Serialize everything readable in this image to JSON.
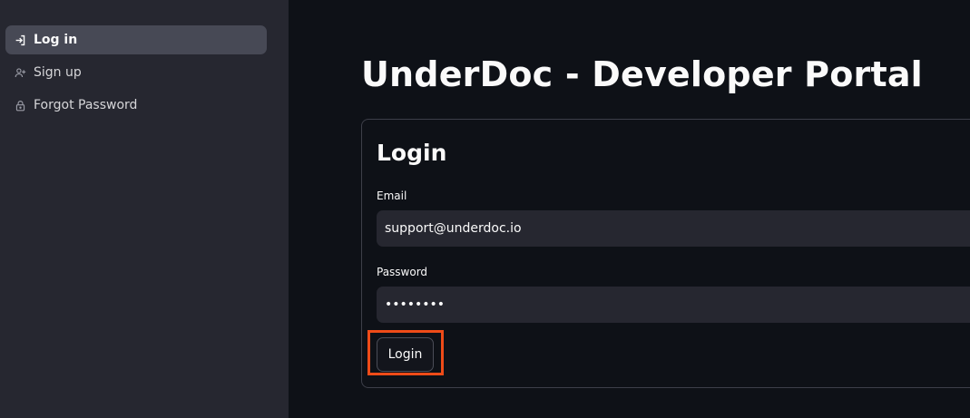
{
  "sidebar": {
    "items": [
      {
        "label": "Log in",
        "icon": "login-icon",
        "active": true
      },
      {
        "label": "Sign up",
        "icon": "person-add-icon",
        "active": false
      },
      {
        "label": "Forgot Password",
        "icon": "lock-icon",
        "active": false
      }
    ]
  },
  "main": {
    "title": "UnderDoc - Developer Portal",
    "form": {
      "title": "Login",
      "email": {
        "label": "Email",
        "value": "support@underdoc.io"
      },
      "password": {
        "label": "Password",
        "value": "••••••••"
      },
      "submit_label": "Login"
    }
  },
  "colors": {
    "sidebar_bg": "#262730",
    "main_bg": "#0e1117",
    "active_item_bg": "#474955",
    "highlight": "#ee4b18"
  }
}
